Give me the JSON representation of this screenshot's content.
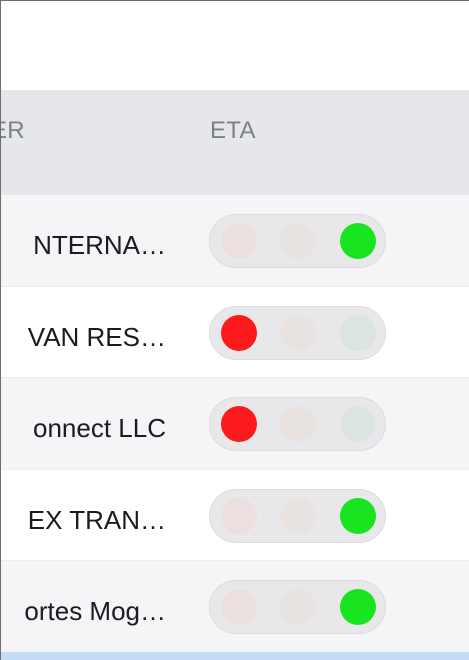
{
  "table": {
    "columns": {
      "carrier": "ER",
      "eta": "ETA"
    },
    "rows": [
      {
        "carrier": "NTERNA…",
        "eta_state": "green"
      },
      {
        "carrier": "VAN RES…",
        "eta_state": "red"
      },
      {
        "carrier": "onnect LLC",
        "eta_state": "red"
      },
      {
        "carrier": "EX TRAN…",
        "eta_state": "green"
      },
      {
        "carrier": "ortes Mog…",
        "eta_state": "green"
      }
    ]
  },
  "colors": {
    "header_bg": "#e6e7eb",
    "row_alt_bg": "#f5f5f8",
    "light_red": "#fc1a1d",
    "light_green": "#18e41f",
    "selection_strip": "#c5dcf6"
  },
  "icons": {
    "eta_indicator": "traffic-light-indicator-icon"
  }
}
